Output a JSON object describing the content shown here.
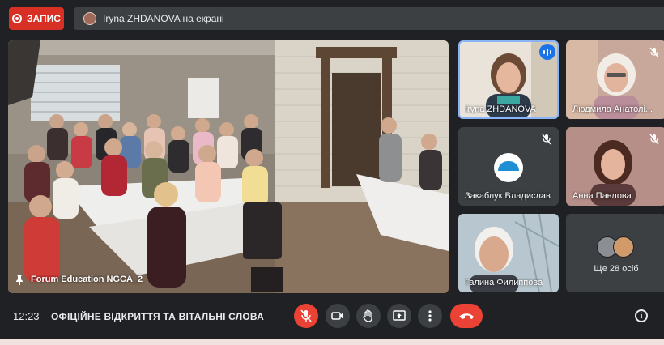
{
  "top": {
    "record_label": "ЗАПИС",
    "presenting_text": "Iryna ZHDANOVA на екрані"
  },
  "stage": {
    "label": "Forum Education NGCA_2"
  },
  "tiles": [
    {
      "name": "Iryna ZHDANOVA",
      "status": "speaking"
    },
    {
      "name": "Людмила Анатолі...",
      "status": "muted"
    },
    {
      "name": "Закаблук Владислав",
      "status": "muted"
    },
    {
      "name": "Анна Павлова",
      "status": "muted"
    },
    {
      "name": "Галина Филиппова",
      "status": "muted"
    }
  ],
  "others": {
    "label": "Ще 28 осіб"
  },
  "bottom": {
    "time": "12:23",
    "meeting_title": "ОФІЦІЙНЕ ВІДКРИТТЯ ТА ВІТАЛЬНІ СЛОВА"
  },
  "colors": {
    "accent_blue": "#1a73e8",
    "record_red": "#d93025",
    "hangup_red": "#ea4335",
    "bg": "#202124",
    "control_bg": "#3c4043"
  },
  "icons": [
    "record-icon",
    "pin-icon",
    "mic-off-icon",
    "camera-icon",
    "raise-hand-icon",
    "present-icon",
    "more-vert-icon",
    "hangup-icon",
    "info-icon",
    "speaking-icon"
  ]
}
